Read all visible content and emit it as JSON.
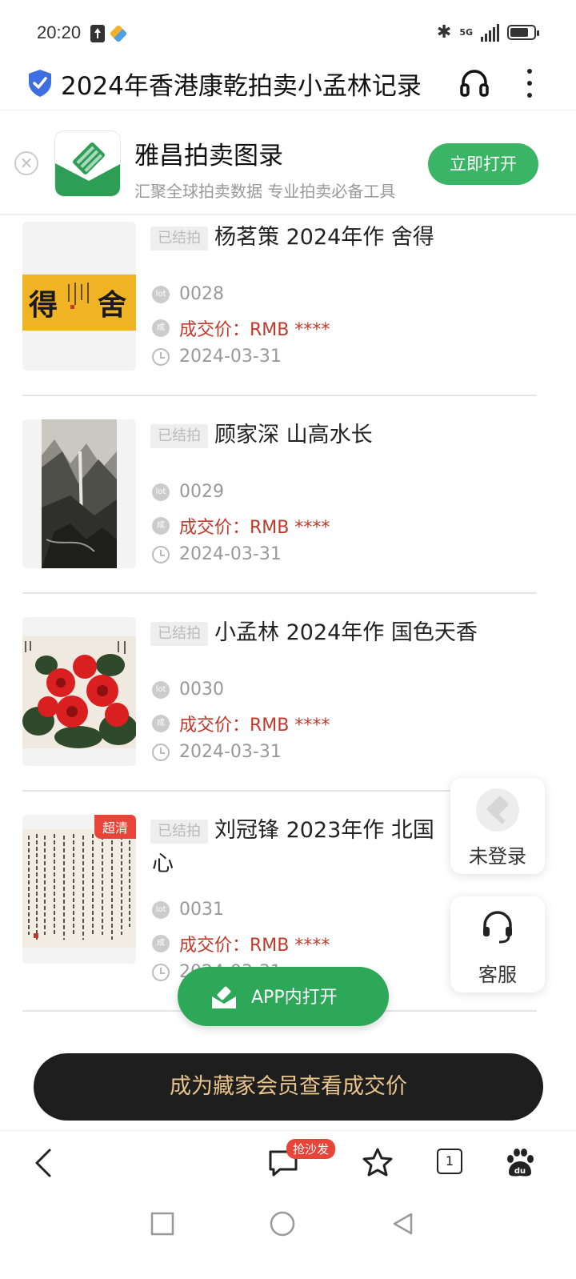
{
  "status_bar": {
    "time": "20:20",
    "network": "5G"
  },
  "header": {
    "title": "2024年香港康乾拍卖小孟林记录"
  },
  "app_banner": {
    "app_name": "雅昌拍卖图录",
    "tagline": "汇聚全球拍卖数据 专业拍卖必备工具",
    "open_label": "立即打开",
    "close_symbol": "×"
  },
  "lots": [
    {
      "status": "已结拍",
      "title": "杨茗策 2024年作 舍得",
      "lot": "0028",
      "price": "成交价：RMB ****",
      "date": "2024-03-31"
    },
    {
      "status": "已结拍",
      "title": "顾家深 山高水长",
      "lot": "0029",
      "price": "成交价：RMB ****",
      "date": "2024-03-31"
    },
    {
      "status": "已结拍",
      "title": "小孟林 2024年作 国色天香",
      "lot": "0030",
      "price": "成交价：RMB ****",
      "date": "2024-03-31"
    },
    {
      "status": "已结拍",
      "title_line1": "刘冠锋 2023年作 北国",
      "title_line2": "心",
      "badge": "超清",
      "lot": "0031",
      "price": "成交价：RMB ****",
      "date": "2024-03-31"
    }
  ],
  "meta_icons": {
    "lot": "lot",
    "price": "成"
  },
  "painting_texts": {
    "calligraphy_left": "得",
    "calligraphy_right": "舍"
  },
  "float_buttons": {
    "login": "未登录",
    "service": "客服"
  },
  "app_open_button": "APP内打开",
  "member_button": "成为藏家会员查看成交价",
  "browser_bar": {
    "comment_badge": "抢沙发",
    "tab_count": "1"
  }
}
